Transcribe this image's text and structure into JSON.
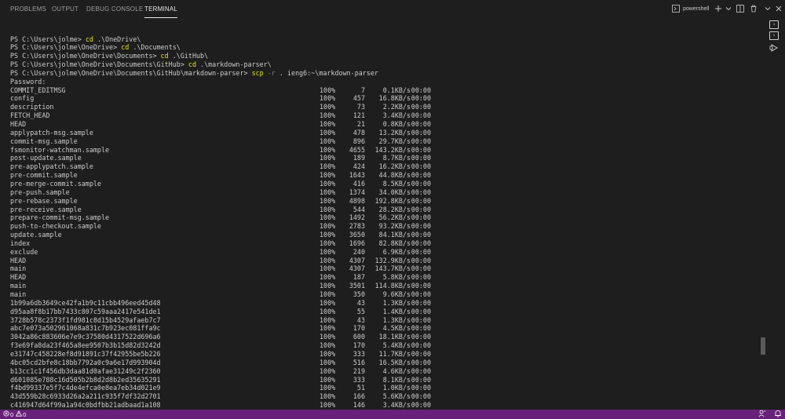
{
  "panel": {
    "tabs": [
      {
        "label": "PROBLEMS"
      },
      {
        "label": "OUTPUT"
      },
      {
        "label": "DEBUG CONSOLE"
      },
      {
        "label": "TERMINAL"
      }
    ],
    "active_tab": "TERMINAL",
    "shell_label": "powershell",
    "toolbar_icons": [
      "terminal-icon",
      "plus-icon",
      "chevron-down-icon",
      "split-terminal-icon",
      "trash-icon",
      "ellipsis-icon",
      "chevron-down-icon",
      "close-icon"
    ]
  },
  "terminal": {
    "commands": [
      {
        "prompt": "PS C:\\Users\\jolme> ",
        "cmd": "cd",
        "args": " .\\OneDrive\\"
      },
      {
        "prompt": "PS C:\\Users\\jolme\\OneDrive> ",
        "cmd": "cd",
        "args": " .\\Documents\\"
      },
      {
        "prompt": "PS C:\\Users\\jolme\\OneDrive\\Documents> ",
        "cmd": "cd",
        "args": " .\\GitHub\\"
      },
      {
        "prompt": "PS C:\\Users\\jolme\\OneDrive\\Documents\\GitHub> ",
        "cmd": "cd",
        "args": " .\\markdown-parser\\"
      },
      {
        "prompt": "PS C:\\Users\\jolme\\OneDrive\\Documents\\GitHub\\markdown-parser> ",
        "cmd": "scp",
        "flag": " -r",
        "args": " . ieng6:~\\markdown-parser"
      }
    ],
    "password_prompt": "Password:",
    "transfers": [
      {
        "name": "COMMIT_EDITMSG",
        "pct": "100%",
        "size": "7",
        "rate": "0.1KB/s",
        "time": "00:00"
      },
      {
        "name": "config",
        "pct": "100%",
        "size": "457",
        "rate": "16.8KB/s",
        "time": "00:00"
      },
      {
        "name": "description",
        "pct": "100%",
        "size": "73",
        "rate": "2.2KB/s",
        "time": "00:00"
      },
      {
        "name": "FETCH_HEAD",
        "pct": "100%",
        "size": "121",
        "rate": "3.4KB/s",
        "time": "00:00"
      },
      {
        "name": "HEAD",
        "pct": "100%",
        "size": "21",
        "rate": "0.8KB/s",
        "time": "00:00"
      },
      {
        "name": "applypatch-msg.sample",
        "pct": "100%",
        "size": "478",
        "rate": "13.2KB/s",
        "time": "00:00"
      },
      {
        "name": "commit-msg.sample",
        "pct": "100%",
        "size": "896",
        "rate": "29.7KB/s",
        "time": "00:00"
      },
      {
        "name": "fsmonitor-watchman.sample",
        "pct": "100%",
        "size": "4655",
        "rate": "143.2KB/s",
        "time": "00:00"
      },
      {
        "name": "post-update.sample",
        "pct": "100%",
        "size": "189",
        "rate": "8.7KB/s",
        "time": "00:00"
      },
      {
        "name": "pre-applypatch.sample",
        "pct": "100%",
        "size": "424",
        "rate": "16.2KB/s",
        "time": "00:00"
      },
      {
        "name": "pre-commit.sample",
        "pct": "100%",
        "size": "1643",
        "rate": "44.8KB/s",
        "time": "00:00"
      },
      {
        "name": "pre-merge-commit.sample",
        "pct": "100%",
        "size": "416",
        "rate": "8.5KB/s",
        "time": "00:00"
      },
      {
        "name": "pre-push.sample",
        "pct": "100%",
        "size": "1374",
        "rate": "34.0KB/s",
        "time": "00:00"
      },
      {
        "name": "pre-rebase.sample",
        "pct": "100%",
        "size": "4898",
        "rate": "192.8KB/s",
        "time": "00:00"
      },
      {
        "name": "pre-receive.sample",
        "pct": "100%",
        "size": "544",
        "rate": "28.2KB/s",
        "time": "00:00"
      },
      {
        "name": "prepare-commit-msg.sample",
        "pct": "100%",
        "size": "1492",
        "rate": "56.2KB/s",
        "time": "00:00"
      },
      {
        "name": "push-to-checkout.sample",
        "pct": "100%",
        "size": "2783",
        "rate": "93.2KB/s",
        "time": "00:00"
      },
      {
        "name": "update.sample",
        "pct": "100%",
        "size": "3650",
        "rate": "84.1KB/s",
        "time": "00:00"
      },
      {
        "name": "index",
        "pct": "100%",
        "size": "1696",
        "rate": "82.8KB/s",
        "time": "00:00"
      },
      {
        "name": "exclude",
        "pct": "100%",
        "size": "240",
        "rate": "6.9KB/s",
        "time": "00:00"
      },
      {
        "name": "HEAD",
        "pct": "100%",
        "size": "4307",
        "rate": "132.9KB/s",
        "time": "00:00"
      },
      {
        "name": "main",
        "pct": "100%",
        "size": "4307",
        "rate": "143.7KB/s",
        "time": "00:00"
      },
      {
        "name": "HEAD",
        "pct": "100%",
        "size": "187",
        "rate": "5.8KB/s",
        "time": "00:00"
      },
      {
        "name": "main",
        "pct": "100%",
        "size": "3501",
        "rate": "114.8KB/s",
        "time": "00:00"
      },
      {
        "name": "main",
        "pct": "100%",
        "size": "350",
        "rate": "9.6KB/s",
        "time": "00:00"
      },
      {
        "name": "1b99a6db3649ce42fa1b9c11cbb496eed45d48",
        "pct": "100%",
        "size": "43",
        "rate": "1.3KB/s",
        "time": "00:00"
      },
      {
        "name": "d95aa8f8b17bb7433c807c59aaa2417e541de1",
        "pct": "100%",
        "size": "55",
        "rate": "1.4KB/s",
        "time": "00:00"
      },
      {
        "name": "3728b578c2373f1fd981c8d15b4529afaeb7c7",
        "pct": "100%",
        "size": "43",
        "rate": "1.3KB/s",
        "time": "00:00"
      },
      {
        "name": "abc7e073a502961068a831c7b923ec081ffa9c",
        "pct": "100%",
        "size": "170",
        "rate": "4.5KB/s",
        "time": "00:00"
      },
      {
        "name": "3042a86c883606e7e9c37580d4317522d696a6",
        "pct": "100%",
        "size": "600",
        "rate": "18.1KB/s",
        "time": "00:00"
      },
      {
        "name": "f3e69fa8da23f465a8ee9507b3b15d82d3242d",
        "pct": "100%",
        "size": "170",
        "rate": "5.4KB/s",
        "time": "00:00"
      },
      {
        "name": "e31747c458228ef8d91891c37f42955be5b226",
        "pct": "100%",
        "size": "333",
        "rate": "11.7KB/s",
        "time": "00:00"
      },
      {
        "name": "4bc05cd2bfe8c18bb7792a0c9a6e17d993904d",
        "pct": "100%",
        "size": "516",
        "rate": "16.5KB/s",
        "time": "00:00"
      },
      {
        "name": "b13cc1c1f456db3daa81d0afae31249c2f2360",
        "pct": "100%",
        "size": "219",
        "rate": "4.6KB/s",
        "time": "00:00"
      },
      {
        "name": "d601085e788c16d505b2b8d2d8b2ed35635291",
        "pct": "100%",
        "size": "333",
        "rate": "8.1KB/s",
        "time": "00:00"
      },
      {
        "name": "f4bd99337e5f7c4de4efca0e8ea7eb34d021e9",
        "pct": "100%",
        "size": "51",
        "rate": "1.0KB/s",
        "time": "00:00"
      },
      {
        "name": "43d559b28c6933d26a2a211c935f7df32d2701",
        "pct": "100%",
        "size": "166",
        "rate": "5.6KB/s",
        "time": "00:00"
      },
      {
        "name": "c416947d64f99a1a94c0bdfbb21adbaad1a108",
        "pct": "100%",
        "size": "146",
        "rate": "3.4KB/s",
        "time": "00:00"
      }
    ]
  },
  "statusbar": {
    "errors": "0",
    "warnings": "0",
    "color": "#68217a"
  },
  "colors": {
    "background": "#1e1e1e",
    "text": "#cccccc",
    "command": "#e5e510",
    "flag": "#808080"
  }
}
